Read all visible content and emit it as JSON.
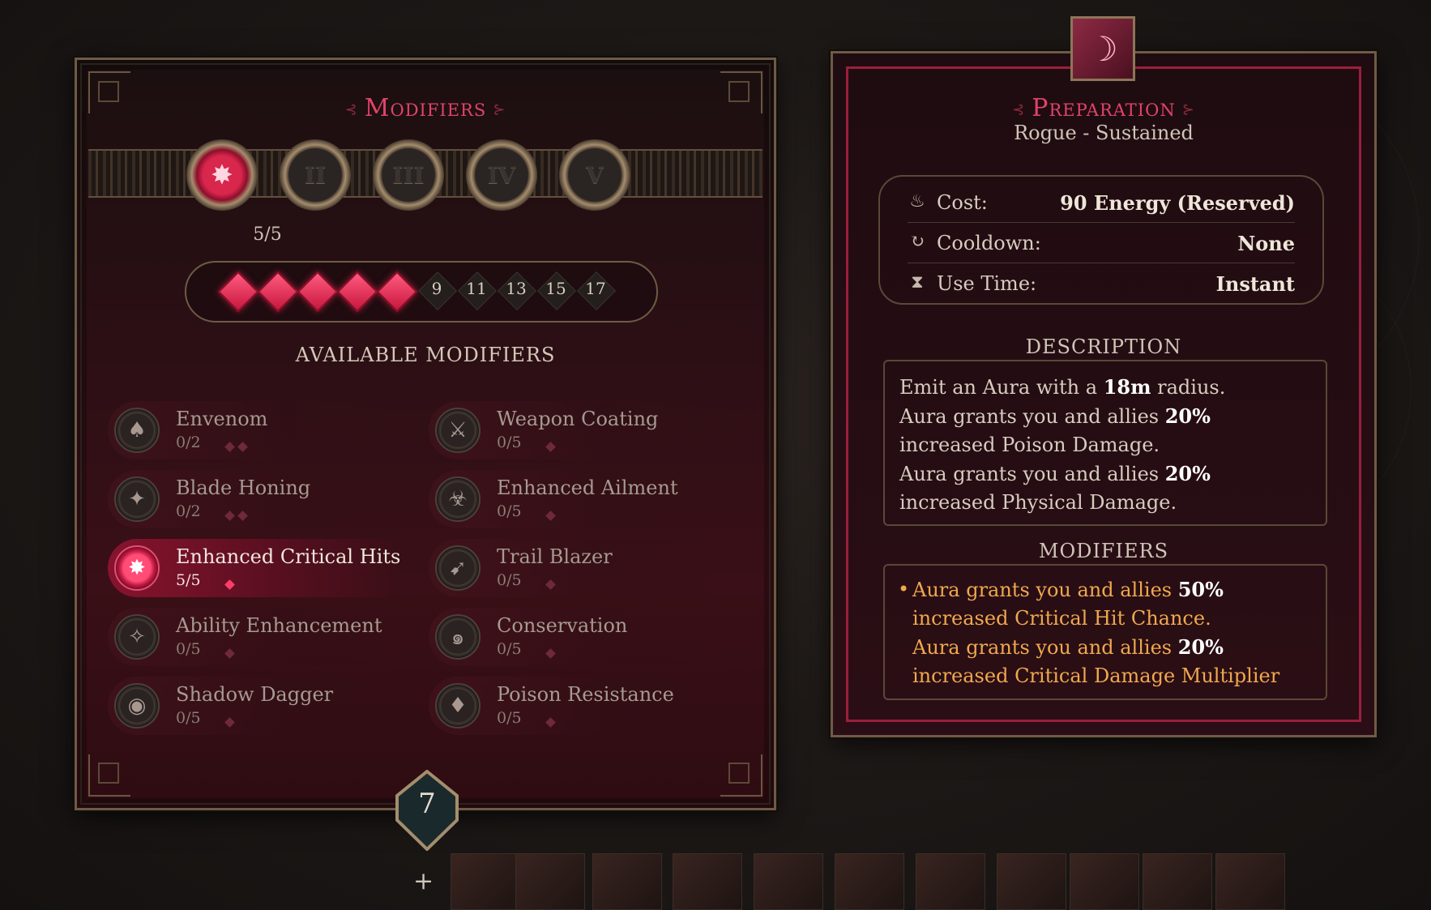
{
  "modifiers_panel": {
    "title": "Modifiers",
    "tiers": [
      "",
      "II",
      "III",
      "IV",
      "V"
    ],
    "active_tier_count": "5/5",
    "pips": {
      "filled": 5,
      "numbers": [
        "9",
        "11",
        "13",
        "15",
        "17"
      ]
    },
    "available_title": "AVAILABLE MODIFIERS",
    "modifiers": [
      {
        "name": "Envenom",
        "count": "0/2",
        "dots": 2,
        "icon": "hood-icon"
      },
      {
        "name": "Weapon Coating",
        "count": "0/5",
        "dots": 1,
        "icon": "blade-coat-icon"
      },
      {
        "name": "Blade Honing",
        "count": "0/2",
        "dots": 2,
        "icon": "honing-icon"
      },
      {
        "name": "Enhanced Ailment",
        "count": "0/5",
        "dots": 1,
        "icon": "ailment-icon"
      },
      {
        "name": "Enhanced Critical Hits",
        "count": "5/5",
        "dots": 1,
        "icon": "critical-icon",
        "active": true
      },
      {
        "name": "Trail Blazer",
        "count": "0/5",
        "dots": 1,
        "icon": "boot-icon"
      },
      {
        "name": "Ability Enhancement",
        "count": "0/5",
        "dots": 1,
        "icon": "feather-icon"
      },
      {
        "name": "Conservation",
        "count": "0/5",
        "dots": 1,
        "icon": "spiral-icon"
      },
      {
        "name": "Shadow Dagger",
        "count": "0/5",
        "dots": 1,
        "icon": "eye-icon"
      },
      {
        "name": "Poison Resistance",
        "count": "0/5",
        "dots": 1,
        "icon": "poison-drop-icon"
      }
    ],
    "points_remaining": "7"
  },
  "skill_panel": {
    "name": "Preparation",
    "subtitle": "Rogue - Sustained",
    "stats": [
      {
        "label": "Cost:",
        "value": "90 Energy (Reserved)",
        "icon": "flame-icon"
      },
      {
        "label": "Cooldown:",
        "value": "None",
        "icon": "cooldown-icon"
      },
      {
        "label": "Use Time:",
        "value": "Instant",
        "icon": "hourglass-icon"
      }
    ],
    "description_title": "DESCRIPTION",
    "description": {
      "l1_pre": "Emit an Aura with a ",
      "l1_b": "18m",
      "l1_post": " radius.",
      "l2_pre": "Aura grants you and allies ",
      "l2_b": "20%",
      "l2_post": " increased Poison Damage.",
      "l3_pre": "Aura grants you and allies ",
      "l3_b": "20%",
      "l3_post": " increased Physical Damage."
    },
    "modifiers_title": "MODIFIERS",
    "modifiers_text": {
      "m1_pre": "Aura grants you and allies ",
      "m1_b": "50%",
      "m1_post": " increased Critical Hit Chance.",
      "m2_pre": "Aura grants you and allies ",
      "m2_b": "20%",
      "m2_post": " increased Critical Damage Multiplier"
    }
  },
  "colors": {
    "accent": "#e0436a",
    "modifier_text": "#f0a84e",
    "frame": "#6e5b45"
  }
}
